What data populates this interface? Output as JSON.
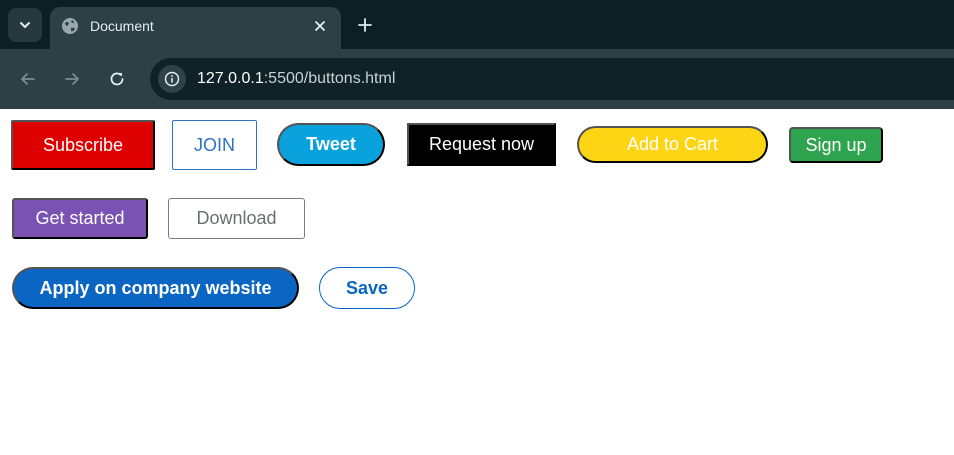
{
  "browser": {
    "tab": {
      "title": "Document",
      "icon": "globe-icon"
    },
    "url_host": "127.0.0.1",
    "url_rest": ":5500/buttons.html",
    "icons": {
      "tab_search": "chevron-down-icon",
      "tab_close": "close-icon",
      "new_tab": "plus-icon",
      "back": "arrow-left-icon",
      "forward": "arrow-right-icon",
      "reload": "reload-icon",
      "site_info": "info-icon"
    },
    "colors": {
      "frame": "#0b1f24",
      "toolbar": "#2c4045",
      "omnibox": "#0f2227"
    }
  },
  "buttons": {
    "row1": {
      "subscribe": "Subscribe",
      "join": "JOIN",
      "tweet": "Tweet",
      "request_now": "Request now",
      "add_to_cart": "Add to Cart",
      "sign_up": "Sign up"
    },
    "row2": {
      "get_started": "Get started",
      "download": "Download"
    },
    "row3": {
      "apply": "Apply on company website",
      "save": "Save"
    }
  },
  "colors": {
    "subscribe": "#de0000",
    "join": "#2e72c5",
    "tweet": "#0aa2dc",
    "request_now": "#000000",
    "add_to_cart": "#fdd514",
    "sign_up": "#2fa44f",
    "get_started": "#7a52b3",
    "download": "#7a7d80",
    "linkedin_blue": "#0a66c2"
  }
}
